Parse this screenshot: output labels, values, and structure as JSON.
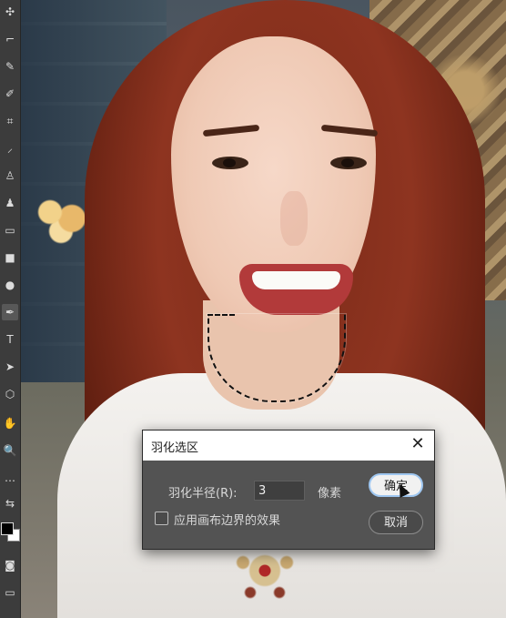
{
  "toolbar": {
    "tools": [
      {
        "icon": "move-icon",
        "glyph": "✣"
      },
      {
        "icon": "marquee-icon",
        "glyph": "⌐"
      },
      {
        "icon": "lasso-icon",
        "glyph": "✎"
      },
      {
        "icon": "brush-icon",
        "glyph": "✐"
      },
      {
        "icon": "crop-icon",
        "glyph": "⌗"
      },
      {
        "icon": "eyedropper-icon",
        "glyph": "⸝"
      },
      {
        "icon": "stamp-icon",
        "glyph": "♙"
      },
      {
        "icon": "history-brush-icon",
        "glyph": "♟"
      },
      {
        "icon": "eraser-icon",
        "glyph": "▭"
      },
      {
        "icon": "gradient-icon",
        "glyph": "■"
      },
      {
        "icon": "blur-icon",
        "glyph": "●"
      },
      {
        "icon": "dodge-icon",
        "glyph": "●"
      },
      {
        "icon": "pen-icon",
        "glyph": "✒"
      },
      {
        "icon": "type-icon",
        "glyph": "T"
      },
      {
        "icon": "path-select-icon",
        "glyph": "➤"
      },
      {
        "icon": "shape-icon",
        "glyph": "⬡"
      },
      {
        "icon": "hand-icon",
        "glyph": "✋"
      },
      {
        "icon": "zoom-icon",
        "glyph": "🔍"
      },
      {
        "icon": "more-icon",
        "glyph": "…"
      },
      {
        "icon": "swap-colors-icon",
        "glyph": "⇆"
      },
      {
        "icon": "quick-mask-icon",
        "glyph": "◙"
      },
      {
        "icon": "screen-mode-icon",
        "glyph": "▭"
      }
    ]
  },
  "dialog": {
    "title": "羽化选区",
    "radius_label": "羽化半径(R):",
    "radius_value": "3",
    "unit": "像素",
    "apply_canvas_bounds_label": "应用画布边界的效果",
    "ok_label": "确定",
    "cancel_label": "取消",
    "close_glyph": "✕"
  }
}
